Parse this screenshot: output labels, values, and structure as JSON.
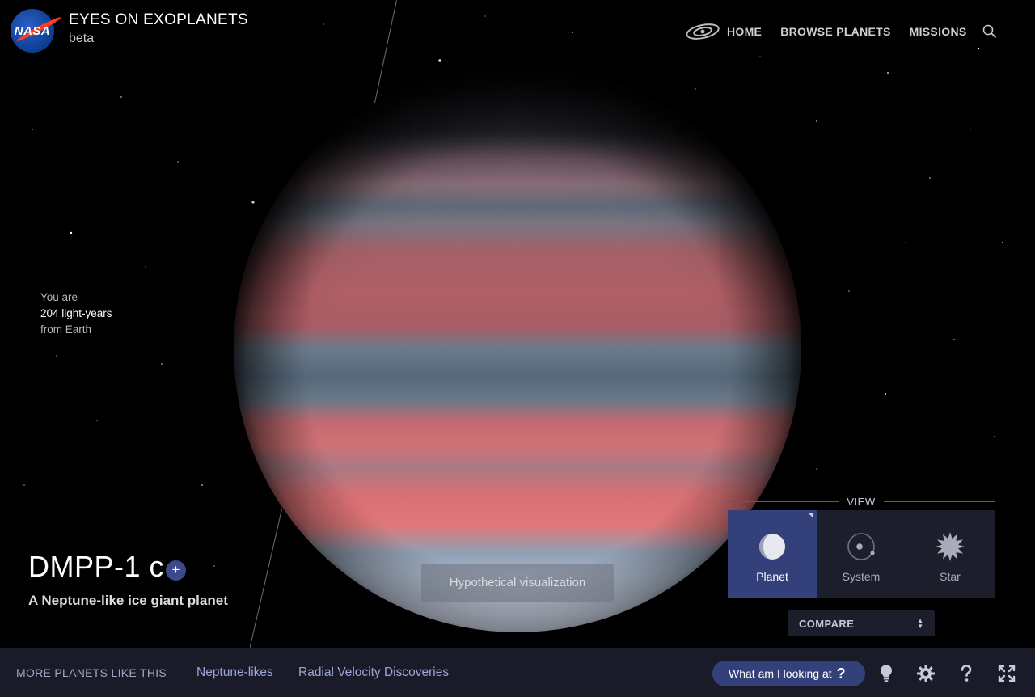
{
  "header": {
    "logo_text": "NASA",
    "app_title": "EYES ON EXOPLANETS",
    "app_subtitle": "beta"
  },
  "nav": {
    "items": [
      "HOME",
      "BROWSE PLANETS",
      "MISSIONS"
    ],
    "icons": [
      "galaxy-icon",
      "search-icon"
    ]
  },
  "distance": {
    "line1": "You are",
    "line2": "204 light-years",
    "line3": "from Earth"
  },
  "planet": {
    "name": "DMPP-1 c",
    "add_label": "+",
    "description": "A Neptune-like ice giant planet"
  },
  "visualization_note": "Hypothetical visualization",
  "view": {
    "label": "VIEW",
    "options": [
      {
        "label": "Planet",
        "icon": "planet-icon",
        "active": true
      },
      {
        "label": "System",
        "icon": "system-icon",
        "active": false
      },
      {
        "label": "Star",
        "icon": "star-icon",
        "active": false
      }
    ]
  },
  "compare": {
    "label": "COMPARE"
  },
  "bottom_bar": {
    "more_label": "MORE PLANETS LIKE THIS",
    "links": [
      "Neptune-likes",
      "Radial Velocity Discoveries"
    ],
    "what_label": "What am I looking at",
    "what_q": "?",
    "tools": [
      "lightbulb-icon",
      "settings-icon",
      "help-icon",
      "fullscreen-icon"
    ]
  },
  "colors": {
    "accent": "#33407a",
    "panel": "#1d1e2c",
    "bar": "#1a1b29"
  }
}
